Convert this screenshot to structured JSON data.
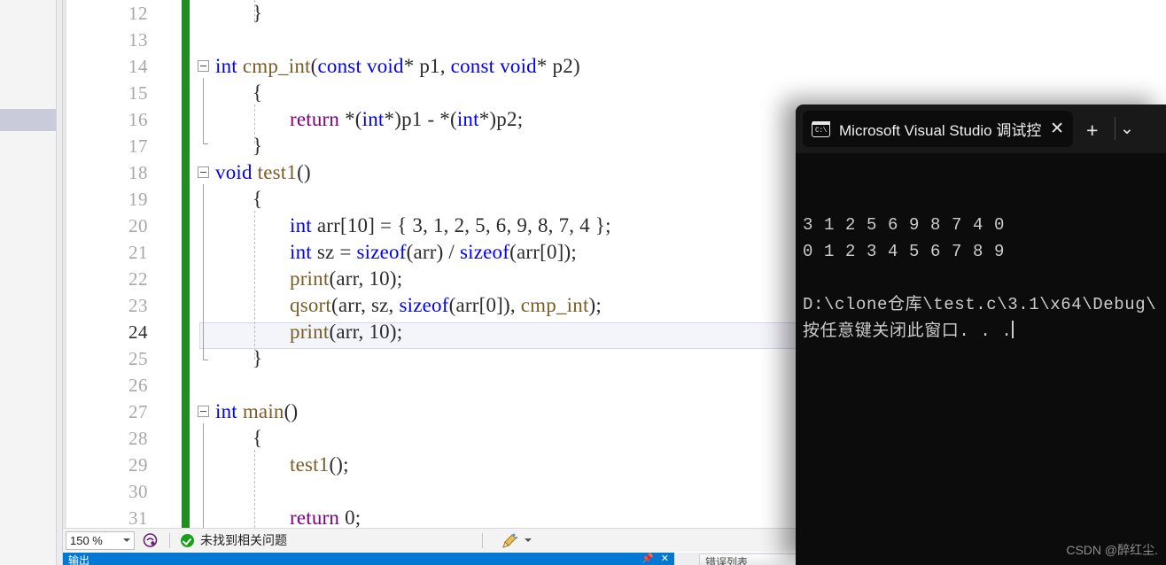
{
  "editor": {
    "first_line_number": 12,
    "current_line": 24,
    "lines": [
      {
        "n": 12,
        "indent": 1,
        "tokens": [
          {
            "t": "}",
            "c": "pun"
          }
        ]
      },
      {
        "n": 13,
        "indent": 0,
        "tokens": []
      },
      {
        "n": 14,
        "indent": 0,
        "fold": "start",
        "tokens": [
          {
            "t": "int",
            "c": "kw"
          },
          {
            "t": " ",
            "c": "pun"
          },
          {
            "t": "cmp_int",
            "c": "fn"
          },
          {
            "t": "(",
            "c": "pun"
          },
          {
            "t": "const",
            "c": "kw"
          },
          {
            "t": " ",
            "c": "pun"
          },
          {
            "t": "void",
            "c": "kw"
          },
          {
            "t": "* ",
            "c": "pun"
          },
          {
            "t": "p1",
            "c": "id"
          },
          {
            "t": ", ",
            "c": "pun"
          },
          {
            "t": "const",
            "c": "kw"
          },
          {
            "t": " ",
            "c": "pun"
          },
          {
            "t": "void",
            "c": "kw"
          },
          {
            "t": "* ",
            "c": "pun"
          },
          {
            "t": "p2",
            "c": "id"
          },
          {
            "t": ")",
            "c": "pun"
          }
        ]
      },
      {
        "n": 15,
        "indent": 1,
        "tokens": [
          {
            "t": "{",
            "c": "pun"
          }
        ]
      },
      {
        "n": 16,
        "indent": 2,
        "tokens": [
          {
            "t": "return",
            "c": "pl"
          },
          {
            "t": " *(",
            "c": "pun"
          },
          {
            "t": "int",
            "c": "kw"
          },
          {
            "t": "*)",
            "c": "pun"
          },
          {
            "t": "p1",
            "c": "id"
          },
          {
            "t": " - *(",
            "c": "pun"
          },
          {
            "t": "int",
            "c": "kw"
          },
          {
            "t": "*)",
            "c": "pun"
          },
          {
            "t": "p2",
            "c": "id"
          },
          {
            "t": ";",
            "c": "pun"
          }
        ]
      },
      {
        "n": 17,
        "indent": 1,
        "tokens": [
          {
            "t": "}",
            "c": "pun"
          }
        ]
      },
      {
        "n": 18,
        "indent": 0,
        "fold": "start",
        "tokens": [
          {
            "t": "void",
            "c": "kw"
          },
          {
            "t": " ",
            "c": "pun"
          },
          {
            "t": "test1",
            "c": "fn"
          },
          {
            "t": "()",
            "c": "pun"
          }
        ]
      },
      {
        "n": 19,
        "indent": 1,
        "tokens": [
          {
            "t": "{",
            "c": "pun"
          }
        ]
      },
      {
        "n": 20,
        "indent": 2,
        "tokens": [
          {
            "t": "int",
            "c": "kw"
          },
          {
            "t": " ",
            "c": "pun"
          },
          {
            "t": "arr",
            "c": "id"
          },
          {
            "t": "[",
            "c": "pun"
          },
          {
            "t": "10",
            "c": "num"
          },
          {
            "t": "] = { ",
            "c": "pun"
          },
          {
            "t": "3, 1, 2, 5, 6, 9, 8, 7, 4",
            "c": "num"
          },
          {
            "t": " };",
            "c": "pun"
          }
        ]
      },
      {
        "n": 21,
        "indent": 2,
        "tokens": [
          {
            "t": "int",
            "c": "kw"
          },
          {
            "t": " ",
            "c": "pun"
          },
          {
            "t": "sz",
            "c": "id"
          },
          {
            "t": " = ",
            "c": "pun"
          },
          {
            "t": "sizeof",
            "c": "kw"
          },
          {
            "t": "(",
            "c": "pun"
          },
          {
            "t": "arr",
            "c": "id"
          },
          {
            "t": ") / ",
            "c": "pun"
          },
          {
            "t": "sizeof",
            "c": "kw"
          },
          {
            "t": "(",
            "c": "pun"
          },
          {
            "t": "arr",
            "c": "id"
          },
          {
            "t": "[",
            "c": "pun"
          },
          {
            "t": "0",
            "c": "num"
          },
          {
            "t": "]);",
            "c": "pun"
          }
        ]
      },
      {
        "n": 22,
        "indent": 2,
        "tokens": [
          {
            "t": "print",
            "c": "fn"
          },
          {
            "t": "(",
            "c": "pun"
          },
          {
            "t": "arr",
            "c": "id"
          },
          {
            "t": ", ",
            "c": "pun"
          },
          {
            "t": "10",
            "c": "num"
          },
          {
            "t": ");",
            "c": "pun"
          }
        ]
      },
      {
        "n": 23,
        "indent": 2,
        "tokens": [
          {
            "t": "qsort",
            "c": "fn"
          },
          {
            "t": "(",
            "c": "pun"
          },
          {
            "t": "arr",
            "c": "id"
          },
          {
            "t": ", ",
            "c": "pun"
          },
          {
            "t": "sz",
            "c": "id"
          },
          {
            "t": ", ",
            "c": "pun"
          },
          {
            "t": "sizeof",
            "c": "kw"
          },
          {
            "t": "(",
            "c": "pun"
          },
          {
            "t": "arr",
            "c": "id"
          },
          {
            "t": "[",
            "c": "pun"
          },
          {
            "t": "0",
            "c": "num"
          },
          {
            "t": "]), ",
            "c": "pun"
          },
          {
            "t": "cmp_int",
            "c": "fn"
          },
          {
            "t": ");",
            "c": "pun"
          }
        ]
      },
      {
        "n": 24,
        "indent": 2,
        "tokens": [
          {
            "t": "print",
            "c": "fn"
          },
          {
            "t": "(",
            "c": "pun"
          },
          {
            "t": "arr",
            "c": "id"
          },
          {
            "t": ", ",
            "c": "pun"
          },
          {
            "t": "10",
            "c": "num"
          },
          {
            "t": ");",
            "c": "pun"
          }
        ]
      },
      {
        "n": 25,
        "indent": 1,
        "tokens": [
          {
            "t": "}",
            "c": "pun"
          }
        ]
      },
      {
        "n": 26,
        "indent": 0,
        "tokens": []
      },
      {
        "n": 27,
        "indent": 0,
        "fold": "start",
        "tokens": [
          {
            "t": "int",
            "c": "kw"
          },
          {
            "t": " ",
            "c": "pun"
          },
          {
            "t": "main",
            "c": "fn"
          },
          {
            "t": "()",
            "c": "pun"
          }
        ]
      },
      {
        "n": 28,
        "indent": 1,
        "tokens": [
          {
            "t": "{",
            "c": "pun"
          }
        ]
      },
      {
        "n": 29,
        "indent": 2,
        "tokens": [
          {
            "t": "test1",
            "c": "fn"
          },
          {
            "t": "();",
            "c": "pun"
          }
        ]
      },
      {
        "n": 30,
        "indent": 0,
        "tokens": []
      },
      {
        "n": 31,
        "indent": 2,
        "tokens": [
          {
            "t": "return",
            "c": "pl"
          },
          {
            "t": " ",
            "c": "pun"
          },
          {
            "t": "0",
            "c": "num"
          },
          {
            "t": ";",
            "c": "pun"
          }
        ]
      }
    ]
  },
  "statusbar": {
    "zoom_level": "150 %",
    "zoom_caret_icon": "chevron-down-icon",
    "intellicode_icon": "intellicode-icon",
    "status_icon": "check-circle-icon",
    "status_text": "未找到相关问题",
    "cleanup_icon": "code-cleanup-broom-icon",
    "cleanup_caret_icon": "chevron-down-icon"
  },
  "bottom_panel": {
    "output_tab_label": "输出",
    "output_pin_icon": "pin-icon",
    "output_close_icon": "close-icon",
    "error_list_tab_label": "错误列表"
  },
  "console": {
    "tab_icon": "console-window-icon",
    "tab_icon_text": "C:\\",
    "tab_title": "Microsoft Visual Studio 调试控",
    "close_icon": "close-icon",
    "new_tab_icon": "plus-icon",
    "dropdown_icon": "chevron-down-icon",
    "output_lines": [
      "3 1 2 5 6 9 8 7 4 0",
      "0 1 2 3 4 5 6 7 8 9",
      "",
      "D:\\clone仓库\\test.c\\3.1\\x64\\Debug\\",
      "按任意键关闭此窗口. . ."
    ]
  },
  "watermark": {
    "text": "CSDN @醉红尘."
  },
  "colors": {
    "keyword": "#0000ff",
    "function": "#795e26",
    "control": "#800080",
    "changebar_green": "#1e8e1e",
    "console_bg": "#0c0c0c",
    "console_title_bg": "#191919",
    "output_tab_blue": "#0078d4",
    "selection_left": "#c9cbdb"
  }
}
